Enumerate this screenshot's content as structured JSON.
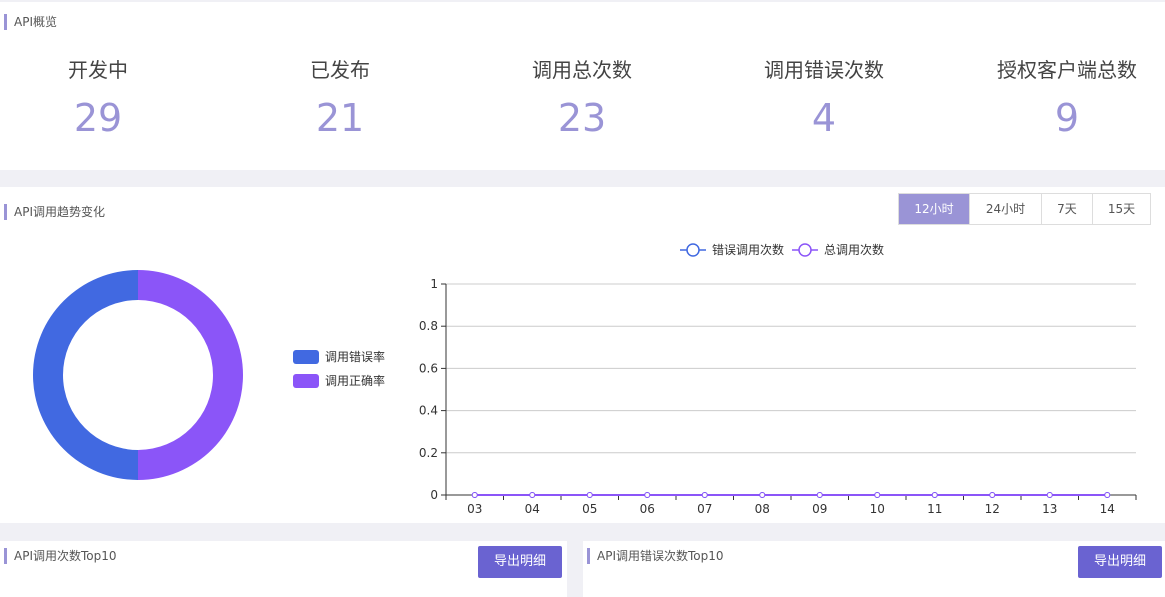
{
  "overview": {
    "title": "API概览",
    "stats": [
      {
        "label": "开发中",
        "value": "29"
      },
      {
        "label": "已发布",
        "value": "21"
      },
      {
        "label": "调用总次数",
        "value": "23"
      },
      {
        "label": "调用错误次数",
        "value": "4"
      },
      {
        "label": "授权客户端总数",
        "value": "9"
      }
    ]
  },
  "trend": {
    "title": "API调用趋势变化",
    "ranges": [
      "12小时",
      "24小时",
      "7天",
      "15天"
    ],
    "active_range": "12小时",
    "donut_legend": [
      {
        "label": "调用错误率",
        "color": "#4169e1"
      },
      {
        "label": "调用正确率",
        "color": "#8b55f8"
      }
    ]
  },
  "chart_data": [
    {
      "type": "pie",
      "variant": "donut",
      "categories": [
        "调用错误率",
        "调用正确率"
      ],
      "values": [
        50,
        50
      ],
      "colors": [
        "#4169e1",
        "#8b55f8"
      ],
      "legend": "right"
    },
    {
      "type": "line",
      "x": [
        "03",
        "04",
        "05",
        "06",
        "07",
        "08",
        "09",
        "10",
        "11",
        "12",
        "13",
        "14"
      ],
      "series": [
        {
          "name": "错误调用次数",
          "values": [
            0,
            0,
            0,
            0,
            0,
            0,
            0,
            0,
            0,
            0,
            0,
            0
          ],
          "color": "#4169e1"
        },
        {
          "name": "总调用次数",
          "values": [
            0,
            0,
            0,
            0,
            0,
            0,
            0,
            0,
            0,
            0,
            0,
            0
          ],
          "color": "#8b55f8"
        }
      ],
      "yticks": [
        "0",
        "0.2",
        "0.4",
        "0.6",
        "0.8",
        "1"
      ],
      "ylim": [
        0,
        1
      ],
      "grid": true,
      "legend": "top-center"
    }
  ],
  "top10": {
    "title": "API调用次数Top10",
    "export_label": "导出明细"
  },
  "error_top10": {
    "title": "API调用错误次数Top10",
    "export_label": "导出明细"
  }
}
